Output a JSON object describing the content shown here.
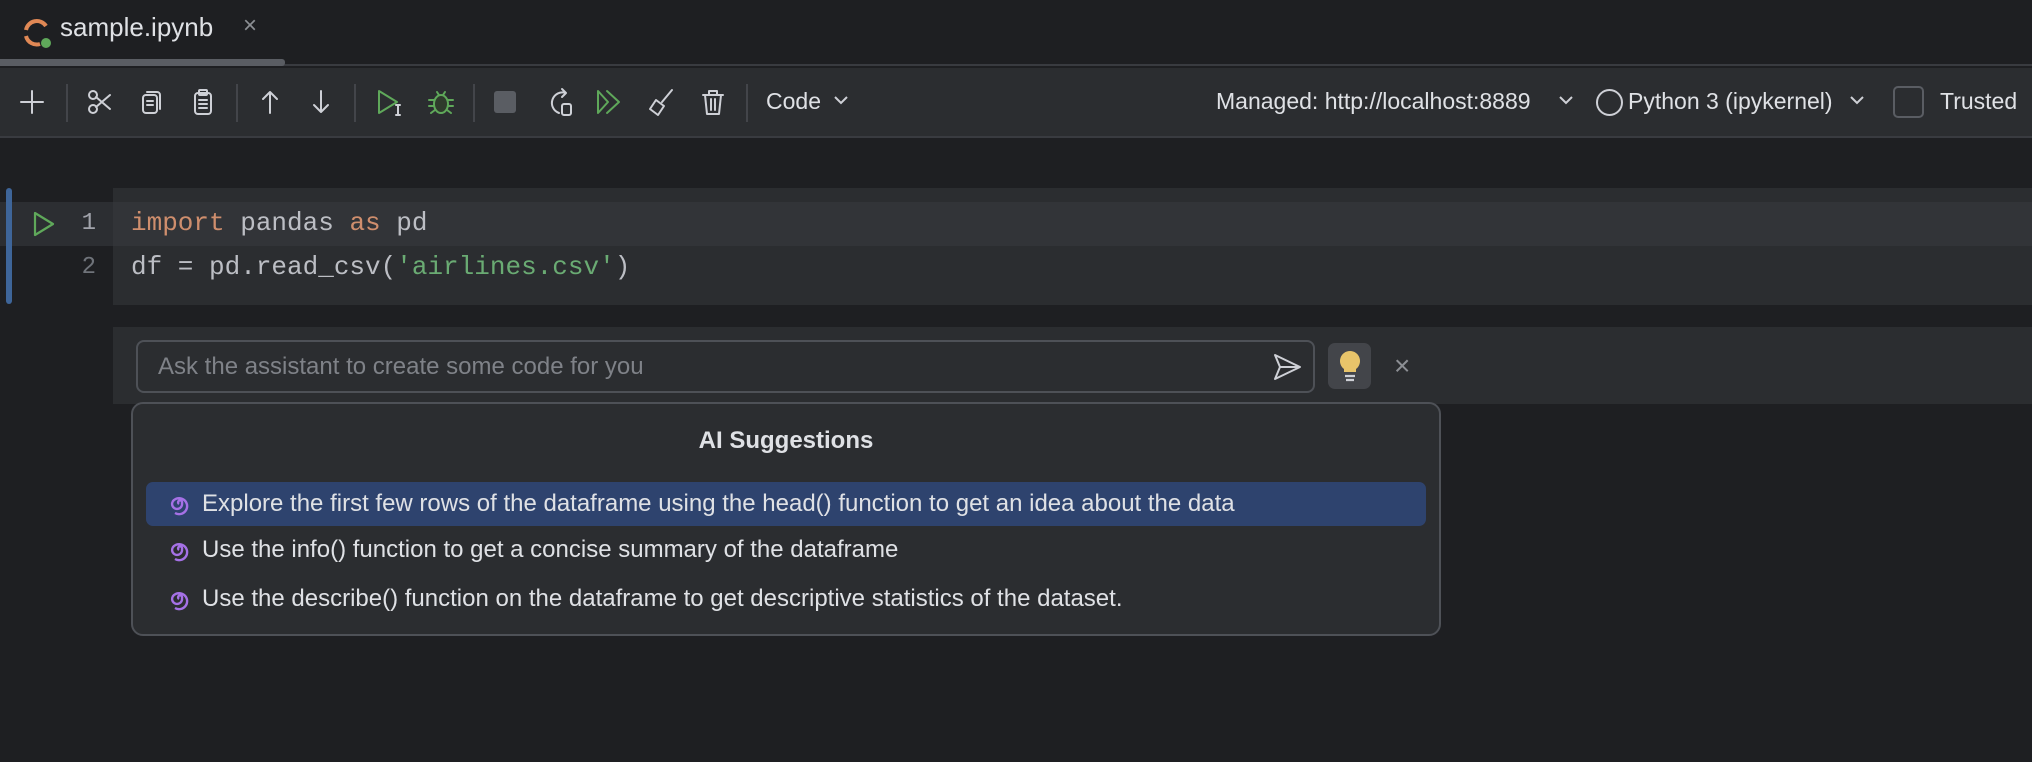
{
  "tab": {
    "title": "sample.ipynb",
    "close": "×"
  },
  "toolbar": {
    "cell_type": "Code",
    "server": "Managed: http://localhost:8889",
    "kernel": "Python 3 (ipykernel)",
    "trusted": "Trusted"
  },
  "cell": {
    "line_numbers": [
      "1",
      "2"
    ],
    "line1": {
      "kw1": "import",
      "t1": " pandas ",
      "kw2": "as",
      "t2": " pd"
    },
    "line2": {
      "t1": "df = pd.read_csv(",
      "str": "'airlines.csv'",
      "t2": ")"
    }
  },
  "assistant": {
    "placeholder": "Ask the assistant to create some code for you",
    "close": "×",
    "suggestions_title": "AI Suggestions",
    "suggestions": [
      "Explore the first few rows of the dataframe using the head() function to get an idea about the data",
      "Use the info() function to get a concise summary of the dataframe",
      "Use the describe() function on the dataframe to get descriptive statistics of the dataset."
    ]
  },
  "colors": {
    "accent": "#3e6599",
    "selection": "#2e436e",
    "ai": "#a571e6",
    "run": "#5fa85a"
  }
}
